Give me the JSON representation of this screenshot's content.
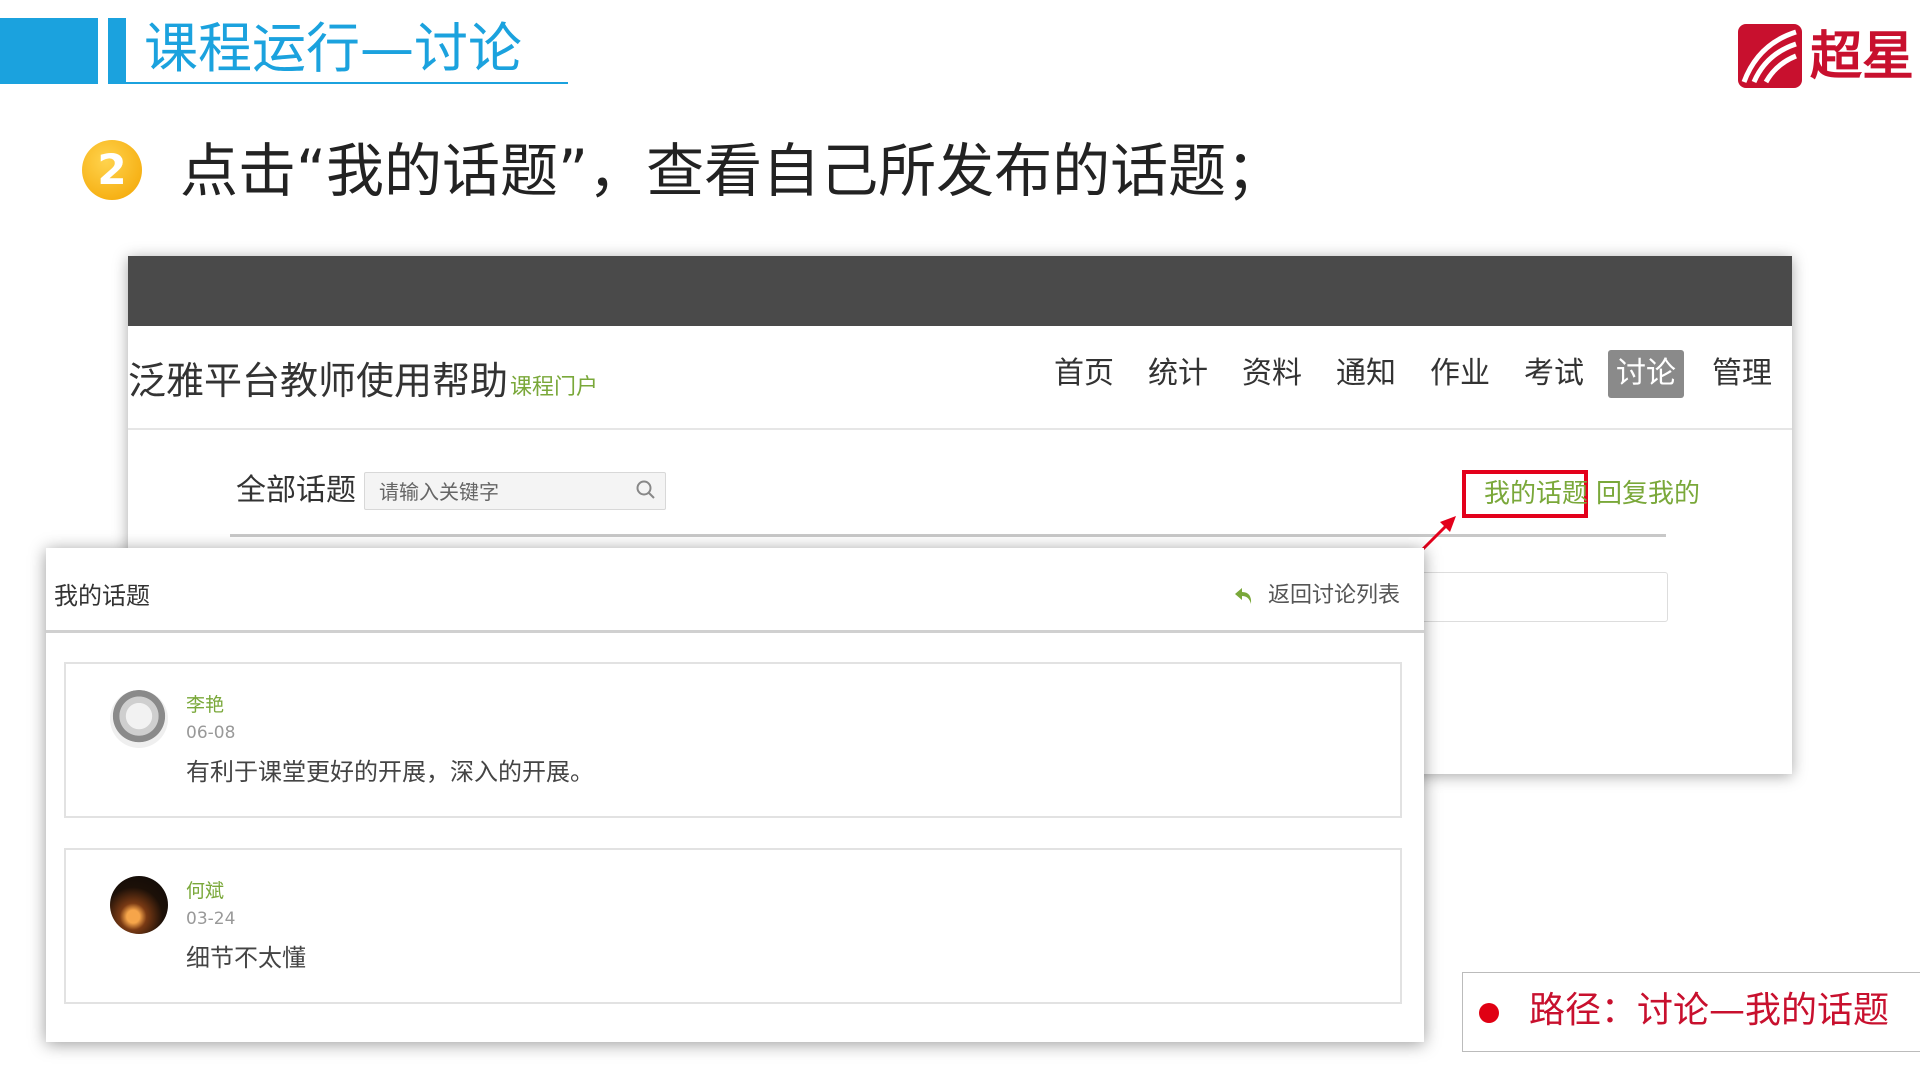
{
  "slide": {
    "title": "课程运行—讨论",
    "logo_text": "超星",
    "step_number": "2",
    "step_text": "点击“我的话题”，查看自己所发布的话题；",
    "path_text": "路径：讨论—我的话题"
  },
  "site": {
    "title": "泛雅平台教师使用帮助",
    "subtitle": "课程门户",
    "nav": [
      "首页",
      "统计",
      "资料",
      "通知",
      "作业",
      "考试",
      "讨论",
      "管理"
    ],
    "active_nav": "讨论"
  },
  "discussion": {
    "all_topics_label": "全部话题",
    "search_placeholder": "请输入关键字",
    "my_topics_link": "我的话题",
    "replies_link": "回复我的"
  },
  "panel": {
    "title": "我的话题",
    "back_label": "返回讨论列表",
    "posts": [
      {
        "author": "李艳",
        "date": "06-08",
        "text": "有利于课堂更好的开展，深入的开展。"
      },
      {
        "author": "何斌",
        "date": "03-24",
        "text": "细节不太懂"
      }
    ]
  },
  "colors": {
    "accent_blue": "#1ba2de",
    "link_green": "#7aa83a",
    "highlight_red": "#e3001b",
    "brand_red": "#c8102e"
  }
}
